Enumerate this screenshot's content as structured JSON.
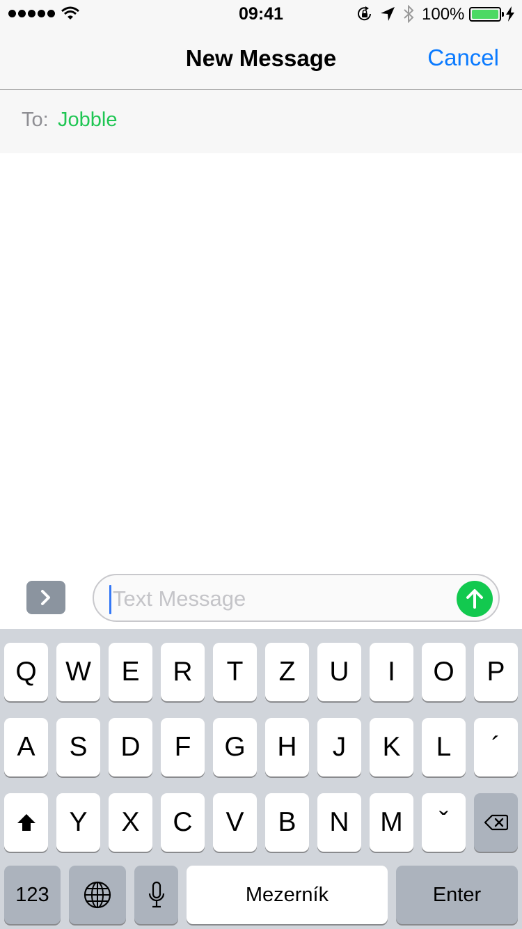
{
  "status_bar": {
    "time": "09:41",
    "battery": "100%"
  },
  "nav": {
    "title": "New Message",
    "cancel": "Cancel"
  },
  "recipient": {
    "label": "To:",
    "name": "Jobble"
  },
  "composer": {
    "placeholder": "Text Message"
  },
  "keyboard": {
    "row1": [
      "Q",
      "W",
      "E",
      "R",
      "T",
      "Z",
      "U",
      "I",
      "O",
      "P"
    ],
    "row2": [
      "A",
      "S",
      "D",
      "F",
      "G",
      "H",
      "J",
      "K",
      "L",
      "´"
    ],
    "row3": [
      "Y",
      "X",
      "C",
      "V",
      "B",
      "N",
      "M",
      "ˇ"
    ],
    "numbers_key": "123",
    "space_key": "Mezerník",
    "return_key": "Enter"
  },
  "colors": {
    "accent_blue": "#0a7aff",
    "recipient_green": "#1fc653",
    "send_green": "#12c94f",
    "battery_green": "#4cd964"
  }
}
